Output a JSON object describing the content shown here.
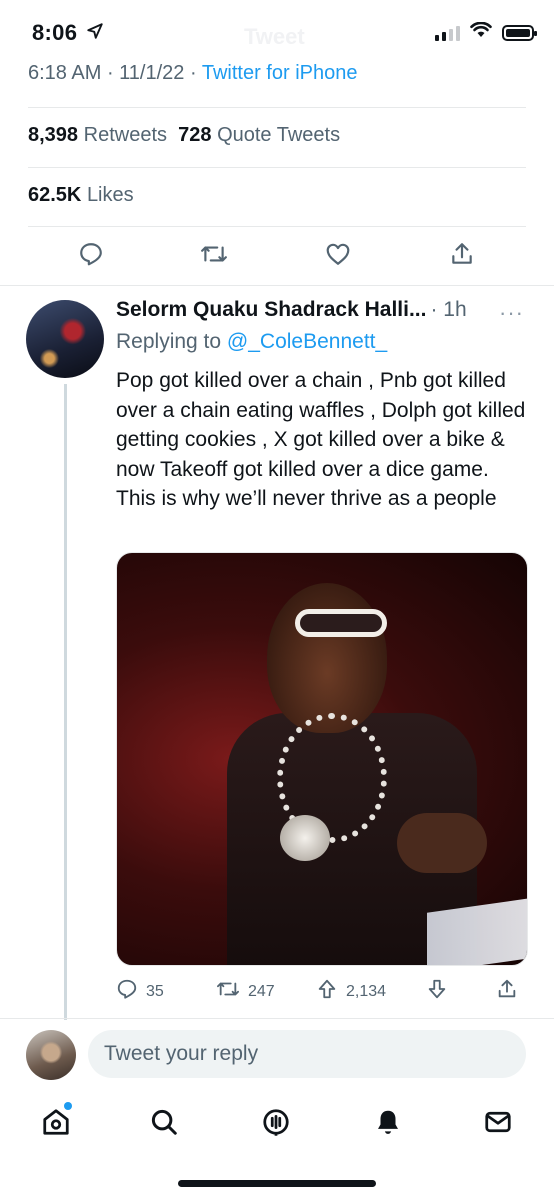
{
  "status_bar": {
    "time": "8:06",
    "ghost_title": "Tweet"
  },
  "tweet_meta": {
    "time": "6:18 AM",
    "separator1": " · ",
    "date": "11/1/22",
    "separator2": " · ",
    "source": "Twitter for iPhone"
  },
  "engagement": {
    "retweets_count": "8,398",
    "retweets_label": "Retweets",
    "quote_count": "728",
    "quote_label": "Quote Tweets",
    "likes_count": "62.5K",
    "likes_label": "Likes"
  },
  "main_actions": [
    "reply-icon",
    "retweet-icon",
    "heart-icon",
    "share-icon"
  ],
  "reply": {
    "author": "Selorm Quaku Shadrack Halli...",
    "time": "· 1h",
    "more": "···",
    "replying_prefix": "Replying to",
    "replying_handle": "@_ColeBennett_",
    "text": "Pop got killed over a chain , Pnb got killed over a chain eating waffles , Dolph got killed getting cookies , X got killed over a bike & now Takeoff got killed over a dice game. This is why we’ll never thrive as a people",
    "replies": "35",
    "retweets": "247",
    "upvotes": "2,134"
  },
  "compose": {
    "placeholder": "Tweet your reply"
  },
  "tabbar": [
    "home-icon",
    "search-icon",
    "spaces-icon",
    "notifications-icon",
    "messages-icon"
  ],
  "colors": {
    "link": "#1d9bf0",
    "muted": "#536471",
    "text": "#0f1419"
  }
}
